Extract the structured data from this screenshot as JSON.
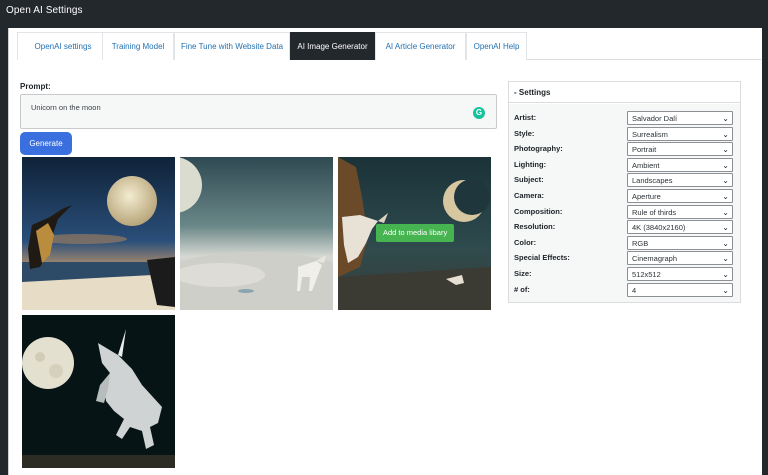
{
  "window": {
    "title": "Open AI Settings"
  },
  "tabs": [
    {
      "label": "OpenAI settings"
    },
    {
      "label": "Training Model"
    },
    {
      "label": "Fine Tune with Website Data"
    },
    {
      "label": "AI Image Generator"
    },
    {
      "label": "AI Article Generator"
    },
    {
      "label": "OpenAI Help"
    }
  ],
  "active_tab": "AI Image Generator",
  "prompt": {
    "label": "Prompt:",
    "value": "Unicorn on the moon",
    "assistant_icon": "grammarly-icon",
    "assistant_glyph": "G"
  },
  "generate_button": {
    "label": "Generate"
  },
  "images": {
    "count": 4,
    "media_button_label": "Add to media libary"
  },
  "settings": {
    "title": "Settings",
    "collapse_glyph": "-",
    "chevron": "⌄",
    "rows": [
      {
        "label": "Artist:",
        "value": "Salvador Dalí"
      },
      {
        "label": "Style:",
        "value": "Surrealism"
      },
      {
        "label": "Photography:",
        "value": "Portrait"
      },
      {
        "label": "Lighting:",
        "value": "Ambient"
      },
      {
        "label": "Subject:",
        "value": "Landscapes"
      },
      {
        "label": "Camera:",
        "value": "Aperture"
      },
      {
        "label": "Composition:",
        "value": "Rule of thirds"
      },
      {
        "label": "Resolution:",
        "value": "4K (3840x2160)"
      },
      {
        "label": "Color:",
        "value": "RGB"
      },
      {
        "label": "Special Effects:",
        "value": "Cinemagraph"
      },
      {
        "label": "Size:",
        "value": "512x512"
      },
      {
        "label": "# of:",
        "value": "4"
      }
    ]
  },
  "colors": {
    "titlebar": "#23282d",
    "active_tab": "#23282d",
    "tab_link": "#2271b1",
    "generate_button": "#3a6fe0",
    "media_button": "#46b450",
    "grammarly": "#15c39a"
  }
}
